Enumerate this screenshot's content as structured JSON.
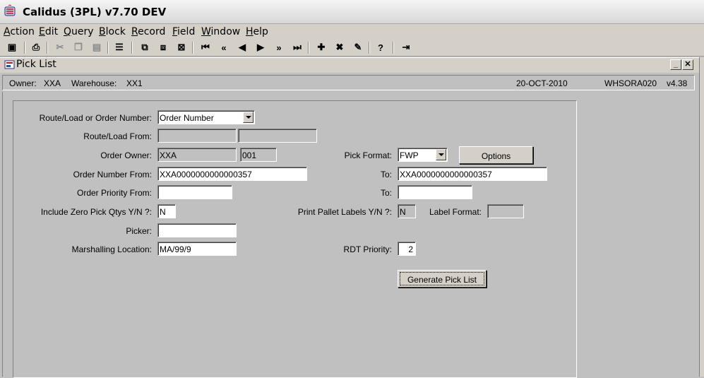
{
  "window": {
    "title": "Calidus (3PL) v7.70 DEV"
  },
  "menu": [
    {
      "mn": "A",
      "rest": "ction"
    },
    {
      "mn": "E",
      "rest": "dit"
    },
    {
      "mn": "Q",
      "rest": "uery"
    },
    {
      "mn": "B",
      "rest": "lock"
    },
    {
      "mn": "R",
      "rest": "ecord"
    },
    {
      "mn": "F",
      "rest": "ield"
    },
    {
      "mn": "W",
      "rest": "indow"
    },
    {
      "mn": "H",
      "rest": "elp"
    }
  ],
  "toolbar": {
    "icons": [
      "save-icon",
      "print-icon",
      "cut-icon",
      "copy-icon",
      "paste-icon",
      "list-icon",
      "query-icon",
      "execute-icon",
      "cancel-query-icon",
      "first-record-icon",
      "previous-block-icon",
      "previous-record-icon",
      "next-record-icon",
      "next-block-icon",
      "last-record-icon",
      "insert-record-icon",
      "delete-record-icon",
      "clear-record-icon",
      "help-icon",
      "exit-icon"
    ]
  },
  "form": {
    "title": "Pick List",
    "owner_label": "Owner:",
    "owner_value": "XXA",
    "warehouse_label": "Warehouse:",
    "warehouse_value": "XX1",
    "date": "20-OCT-2010",
    "form_id": "WHSORA020",
    "version": "v4.38",
    "fields": {
      "route_or_order_label": "Route/Load or Order Number:",
      "route_or_order_value": "Order Number",
      "route_load_from_label": "Route/Load From:",
      "route_load_from_value": "",
      "route_load_from_value2": "",
      "order_owner_label": "Order Owner:",
      "order_owner_value": "XXA",
      "order_owner_code": "001",
      "pick_format_label": "Pick Format:",
      "pick_format_value": "FWP",
      "options_button": "Options",
      "order_number_from_label": "Order Number From:",
      "order_number_from_value": "XXA0000000000000357",
      "order_number_to_label": "To:",
      "order_number_to_value": "XXA0000000000000357",
      "order_priority_from_label": "Order Priority From:",
      "order_priority_from_value": "",
      "order_priority_to_label": "To:",
      "order_priority_to_value": "",
      "include_zero_label": "Include Zero Pick Qtys Y/N ?:",
      "include_zero_value": "N",
      "print_pallet_label": "Print Pallet Labels Y/N ?:",
      "print_pallet_value": "N",
      "label_format_label": "Label Format:",
      "label_format_value": "",
      "picker_label": "Picker:",
      "picker_value": "",
      "marshalling_label": "Marshalling Location:",
      "marshalling_value": "MA/99/9",
      "rdt_priority_label": "RDT Priority:",
      "rdt_priority_value": "2",
      "generate_button": "Generate Pick List"
    }
  }
}
